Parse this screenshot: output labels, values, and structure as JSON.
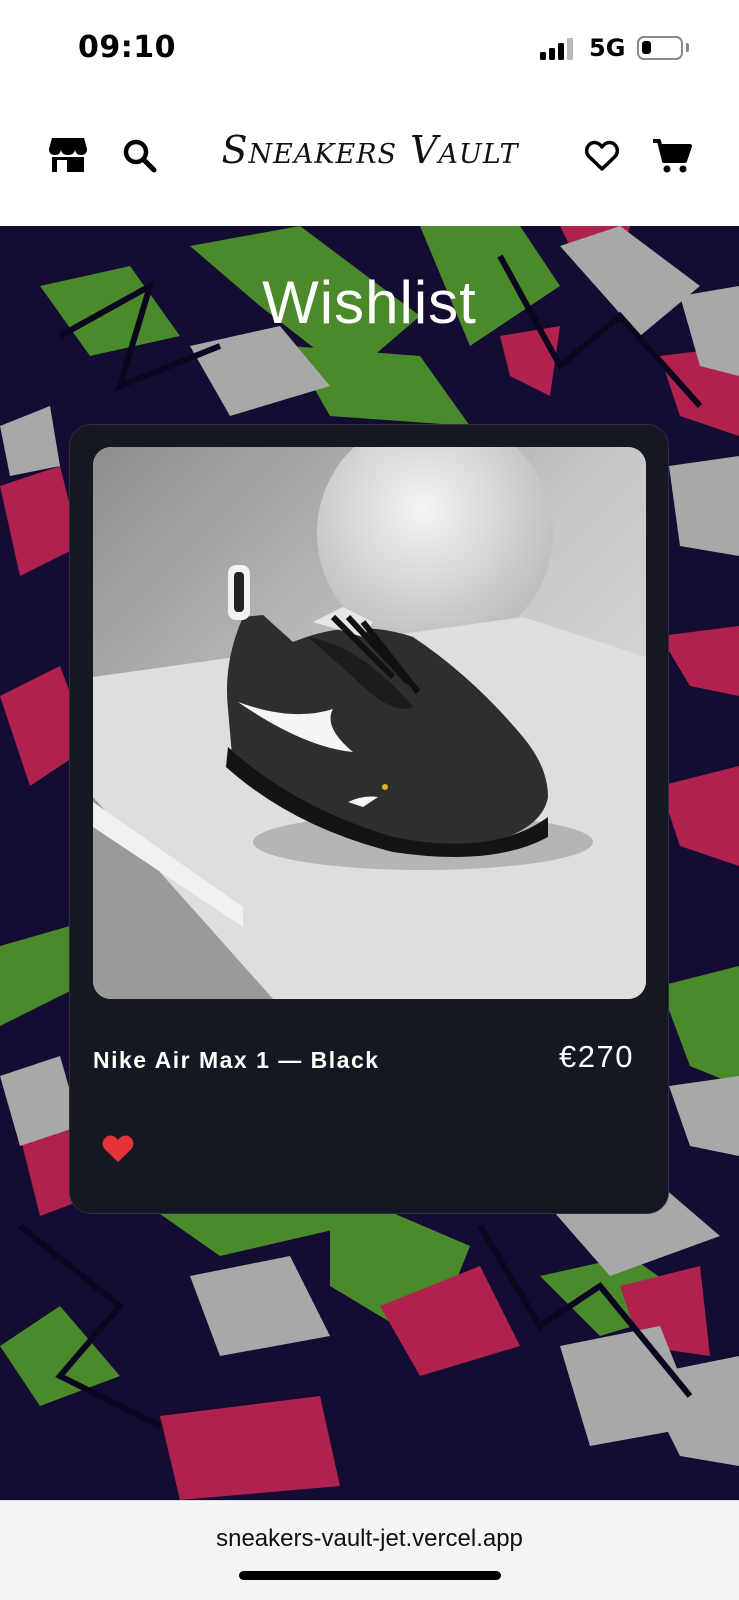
{
  "status_bar": {
    "time": "09:10",
    "network": "5G",
    "battery_level": 0.25,
    "signal_bars_active": 3,
    "signal_bars_total": 4
  },
  "header": {
    "brand": "Sneakers Vault",
    "icons": [
      "store-icon",
      "search-icon",
      "heart-icon",
      "cart-icon"
    ]
  },
  "page": {
    "title": "Wishlist"
  },
  "wishlist": {
    "items": [
      {
        "name": "Nike Air Max 1 — Black",
        "price": "€270",
        "favorited": true,
        "image_icon": "sneaker-image"
      }
    ]
  },
  "browser": {
    "url": "sneakers-vault-jet.vercel.app"
  },
  "colors": {
    "hero_background": "#140c33",
    "card_background": "#151820",
    "accent_green": "#4a8a2a",
    "accent_magenta": "#b0224e",
    "accent_grey": "#a8a8a8",
    "heart_red": "#e5323b"
  }
}
